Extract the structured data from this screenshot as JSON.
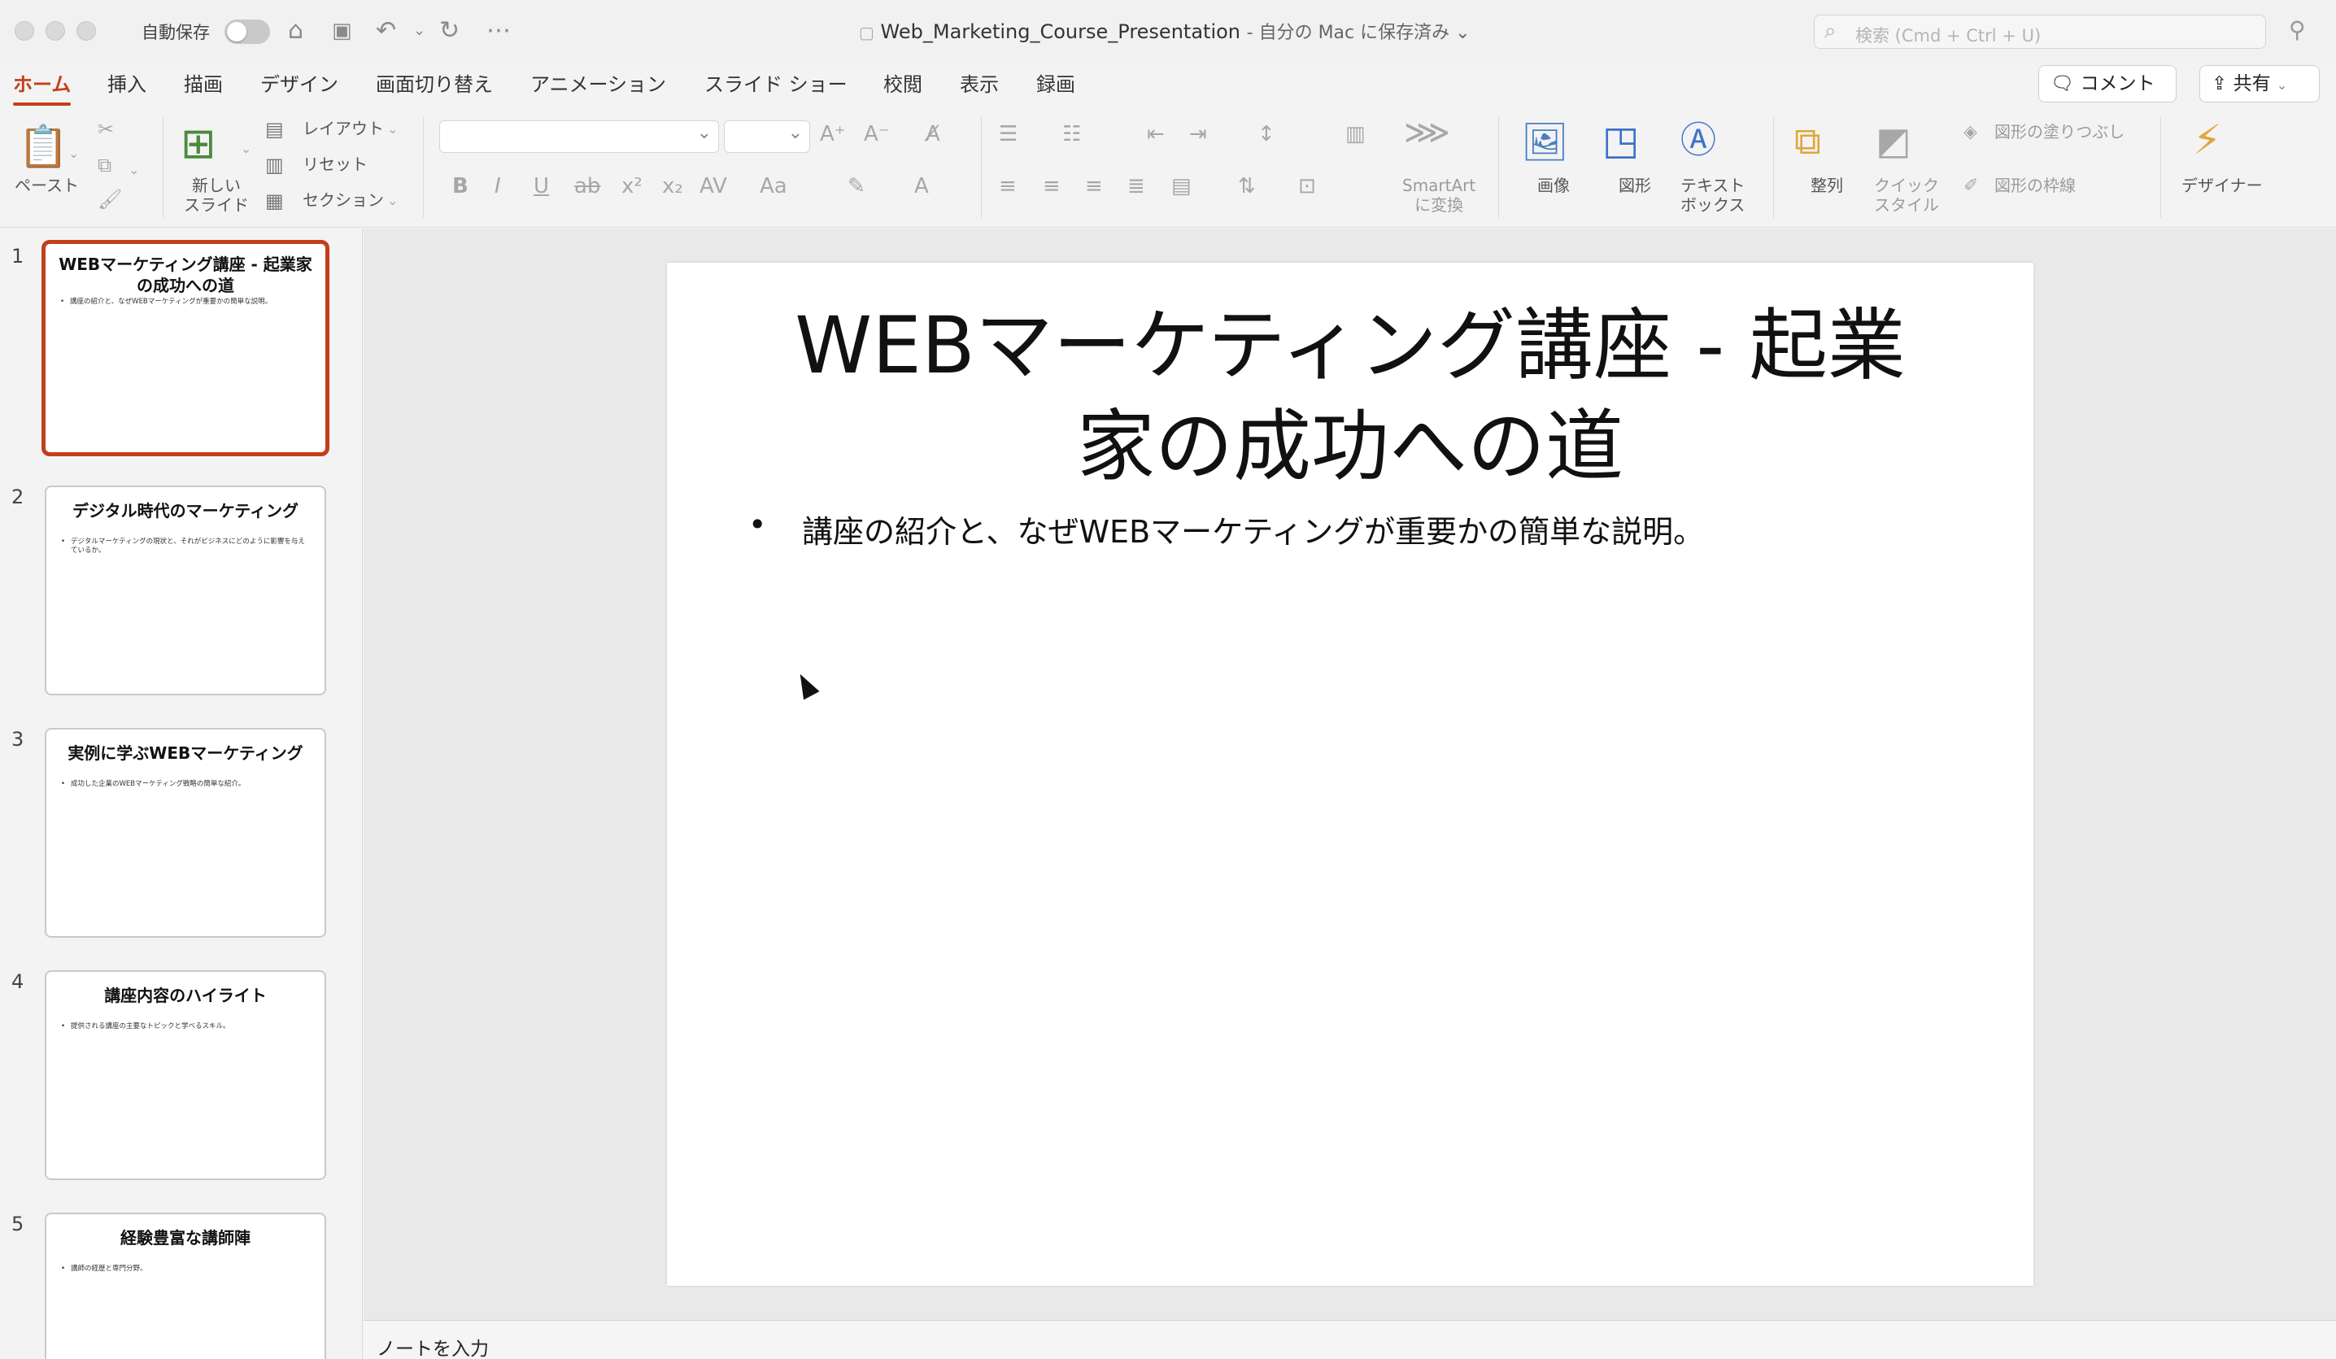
{
  "titlebar": {
    "autosave_label": "自動保存",
    "doc_title": "Web_Marketing_Course_Presentation",
    "doc_status": "- 自分の Mac に保存済み ⌄",
    "search_placeholder": "検索 (Cmd + Ctrl + U)"
  },
  "menu": {
    "tabs": [
      "ホーム",
      "挿入",
      "描画",
      "デザイン",
      "画面切り替え",
      "アニメーション",
      "スライド ショー",
      "校閲",
      "表示",
      "録画"
    ],
    "comment_label": "コメント",
    "share_label": "共有"
  },
  "ribbon": {
    "paste": "ペースト",
    "new_slide_1": "新しい",
    "new_slide_2": "スライド",
    "layout": "レイアウト",
    "reset": "リセット",
    "section": "セクション",
    "smartart_1": "SmartArt",
    "smartart_2": "に変換",
    "picture": "画像",
    "shapes": "図形",
    "textbox_1": "テキスト",
    "textbox_2": "ボックス",
    "arrange": "整列",
    "quickstyle_1": "クイック",
    "quickstyle_2": "スタイル",
    "shape_fill": "図形の塗りつぶし",
    "shape_outline": "図形の枠線",
    "designer": "デザイナー"
  },
  "slides": [
    {
      "num": "1",
      "title": "WEBマーケティング講座 - 起業家の成功への道",
      "bullet": "講座の紹介と、なぜWEBマーケティングが重要かの簡単な説明。"
    },
    {
      "num": "2",
      "title": "デジタル時代のマーケティング",
      "bullet": "デジタルマーケティングの現状と、それがビジネスにどのように影響を与えているか。"
    },
    {
      "num": "3",
      "title": "実例に学ぶWEBマーケティング",
      "bullet": "成功した企業のWEBマーケティング戦略の簡単な紹介。"
    },
    {
      "num": "4",
      "title": "講座内容のハイライト",
      "bullet": "提供される講座の主要なトピックと学べるスキル。"
    },
    {
      "num": "5",
      "title": "経験豊富な講師陣",
      "bullet": "講師の経歴と専門分野。"
    }
  ],
  "current_slide": {
    "title_line1": "WEBマーケティング講座 - 起業",
    "title_line2": "家の成功への道",
    "bullet": "講座の紹介と、なぜWEBマーケティングが重要かの簡単な説明。"
  },
  "notes_placeholder": "ノートを入力",
  "colors": {
    "accent": "#c43e1c"
  }
}
